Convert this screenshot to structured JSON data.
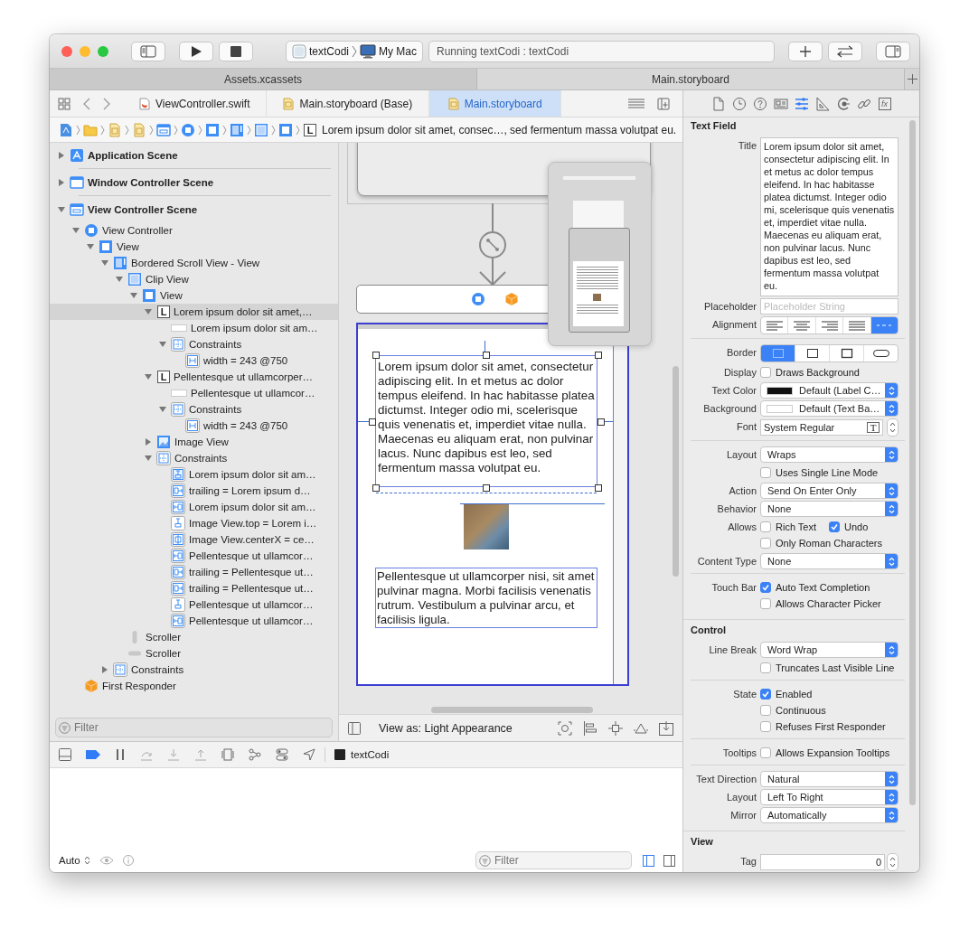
{
  "toolbar": {
    "scheme": {
      "target": "textCodi",
      "destination": "My Mac"
    },
    "activity": "Running textCodi : textCodi"
  },
  "window_tabs": [
    {
      "label": "Assets.xcassets",
      "selected": false
    },
    {
      "label": "Main.storyboard",
      "selected": true
    }
  ],
  "editor_tabs": [
    {
      "label": "ViewController.swift",
      "kind": "swift",
      "selected": false
    },
    {
      "label": "Main.storyboard (Base)",
      "kind": "storyboard",
      "selected": false
    },
    {
      "label": "Main.storyboard",
      "kind": "storyboard",
      "selected": true
    }
  ],
  "jump_bar": {
    "crumbs": [
      {
        "kind": "project"
      },
      {
        "kind": "folder"
      },
      {
        "kind": "storyboard"
      },
      {
        "kind": "storyboard"
      },
      {
        "kind": "vc-scene"
      },
      {
        "kind": "view-controller"
      },
      {
        "kind": "view"
      },
      {
        "kind": "scroll-view"
      },
      {
        "kind": "clip-view"
      },
      {
        "kind": "view"
      },
      {
        "kind": "label",
        "badge": "L",
        "label": "Lorem ipsum dolor sit amet, consec…, sed fermentum massa volutpat eu."
      }
    ]
  },
  "outline": [
    {
      "label": "Application Scene",
      "kind": "app-scene",
      "expanded": false,
      "selected": false
    },
    {
      "label": "Window Controller Scene",
      "kind": "window-scene",
      "expanded": false,
      "selected": false
    },
    {
      "label": "View Controller Scene",
      "kind": "vc-scene",
      "expanded": true,
      "selected": false,
      "children": [
        {
          "label": "View Controller",
          "kind": "view-controller",
          "expanded": true,
          "selected": false,
          "children": [
            {
              "label": "View",
              "kind": "view",
              "expanded": true,
              "selected": false,
              "children": [
                {
                  "label": "Bordered Scroll View - View",
                  "kind": "scroll-view",
                  "expanded": true,
                  "selected": false,
                  "children": [
                    {
                      "label": "Clip View",
                      "kind": "clip-view",
                      "expanded": true,
                      "selected": false,
                      "children": [
                        {
                          "label": "View",
                          "kind": "view",
                          "expanded": true,
                          "selected": false,
                          "children": [
                            {
                              "label": "Lorem ipsum dolor sit amet,…",
                              "kind": "label",
                              "badge": "L",
                              "expanded": true,
                              "selected": true,
                              "children": [
                                {
                                  "label": "Lorem ipsum dolor sit am…",
                                  "kind": "text-cell",
                                  "selected": false
                                },
                                {
                                  "label": "Constraints",
                                  "kind": "constraints",
                                  "expanded": true,
                                  "selected": false,
                                  "children": [
                                    {
                                      "label": "width = 243 @750",
                                      "kind": "width-constraint",
                                      "selected": false
                                    }
                                  ]
                                }
                              ]
                            },
                            {
                              "label": "Pellentesque ut ullamcorper…",
                              "kind": "label",
                              "badge": "L",
                              "expanded": true,
                              "selected": false,
                              "children": [
                                {
                                  "label": "Pellentesque ut ullamcor…",
                                  "kind": "text-cell",
                                  "selected": false
                                },
                                {
                                  "label": "Constraints",
                                  "kind": "constraints",
                                  "expanded": true,
                                  "selected": false,
                                  "children": [
                                    {
                                      "label": "width = 243 @750",
                                      "kind": "width-constraint",
                                      "selected": false
                                    }
                                  ]
                                }
                              ]
                            },
                            {
                              "label": "Image View",
                              "kind": "image-view",
                              "expanded": false,
                              "selected": false
                            },
                            {
                              "label": "Constraints",
                              "kind": "constraints",
                              "expanded": true,
                              "selected": false,
                              "children": [
                                {
                                  "label": "Lorem ipsum dolor sit am…",
                                  "kind": "vertical-constraint",
                                  "selected": false
                                },
                                {
                                  "label": "trailing = Lorem ipsum d…",
                                  "kind": "trailing-constraint",
                                  "selected": false
                                },
                                {
                                  "label": "Lorem ipsum dolor sit am…",
                                  "kind": "leading-constraint",
                                  "selected": false
                                },
                                {
                                  "label": "Image View.top = Lorem i…",
                                  "kind": "top-constraint",
                                  "selected": false
                                },
                                {
                                  "label": "Image View.centerX = ce…",
                                  "kind": "center-constraint",
                                  "selected": false
                                },
                                {
                                  "label": "Pellentesque ut ullamcor…",
                                  "kind": "leading-constraint",
                                  "selected": false
                                },
                                {
                                  "label": "trailing = Pellentesque ut…",
                                  "kind": "trailing-constraint",
                                  "selected": false
                                },
                                {
                                  "label": "trailing = Pellentesque ut…",
                                  "kind": "trailing-constraint",
                                  "selected": false
                                },
                                {
                                  "label": "Pellentesque ut ullamcor…",
                                  "kind": "top-constraint",
                                  "selected": false
                                },
                                {
                                  "label": "Pellentesque ut ullamcor…",
                                  "kind": "leading-constraint",
                                  "selected": false
                                }
                              ]
                            }
                          ]
                        }
                      ]
                    },
                    {
                      "label": "Scroller",
                      "kind": "scroller-v",
                      "selected": false
                    },
                    {
                      "label": "Scroller",
                      "kind": "scroller-h",
                      "selected": false
                    }
                  ]
                },
                {
                  "label": "Constraints",
                  "kind": "constraints",
                  "expanded": false,
                  "selected": false
                }
              ]
            }
          ]
        },
        {
          "label": "First Responder",
          "kind": "first-responder",
          "selected": false
        }
      ]
    }
  ],
  "outline_filter": {
    "placeholder": "Filter"
  },
  "canvas": {
    "labels": [
      "Lorem ipsum dolor sit amet, consectetur adipiscing elit. In et metus ac dolor tempus eleifend. In hac habitasse platea dictumst. Integer odio mi, scelerisque quis venenatis et, imperdiet vitae nulla. Maecenas eu aliquam erat, non pulvinar lacus. Nunc dapibus est leo, sed fermentum massa volutpat eu.",
      "Pellentesque ut ullamcorper nisi, sit amet pulvinar magna. Morbi facilisis venenatis rutrum. Vestibulum a pulvinar arcu, et facilisis ligula."
    ],
    "view_as": "View as: Light Appearance"
  },
  "debug_bar": {
    "process": "textCodi"
  },
  "console": {
    "mode": "Auto",
    "filter": {
      "placeholder": "Filter"
    }
  },
  "inspector": {
    "tabs": [
      {
        "kind": "file",
        "selected": false
      },
      {
        "kind": "history",
        "selected": false
      },
      {
        "kind": "help",
        "selected": false
      },
      {
        "kind": "identity",
        "selected": false
      },
      {
        "kind": "attributes",
        "selected": true
      },
      {
        "kind": "size",
        "selected": false
      },
      {
        "kind": "connections",
        "selected": false
      },
      {
        "kind": "bindings",
        "selected": false
      },
      {
        "kind": "effects",
        "glyph": "fx",
        "selected": false
      }
    ],
    "sections": [
      {
        "title": "Text Field",
        "groups": [
          {
            "rows": [
              {
                "kind": "textarea",
                "label": "Title",
                "value": "Lorem ipsum dolor sit amet, consectetur adipiscing elit. In et metus ac dolor tempus eleifend. In hac habitasse platea dictumst. Integer odio mi, scelerisque quis venenatis et, imperdiet vitae nulla. Maecenas eu aliquam erat, non pulvinar lacus. Nunc dapibus est leo, sed fermentum massa volutpat eu."
              },
              {
                "kind": "field",
                "label": "Placeholder",
                "placeholder": "Placeholder String"
              },
              {
                "kind": "segmented",
                "label": "Alignment",
                "segments": [
                  {
                    "kind": "align-left",
                    "selected": false
                  },
                  {
                    "kind": "align-center",
                    "selected": false
                  },
                  {
                    "kind": "align-right",
                    "selected": false
                  },
                  {
                    "kind": "align-justify",
                    "selected": false
                  },
                  {
                    "kind": "align-natural",
                    "selected": true
                  }
                ]
              }
            ]
          },
          {
            "rows": [
              {
                "kind": "segmented",
                "label": "Border",
                "segments": [
                  {
                    "kind": "border-none",
                    "selected": true
                  },
                  {
                    "kind": "border-line",
                    "selected": false
                  },
                  {
                    "kind": "border-bezel",
                    "selected": false
                  },
                  {
                    "kind": "border-rounded",
                    "selected": false
                  }
                ]
              },
              {
                "kind": "checks",
                "label": "Display",
                "lines": [
                  [
                    {
                      "label": "Draws Background",
                      "checked": false
                    }
                  ]
                ]
              },
              {
                "kind": "popup",
                "label": "Text Color",
                "value": "Default (Label C…",
                "color": "#111111"
              },
              {
                "kind": "popup",
                "label": "Background",
                "value": "Default (Text Ba…",
                "color": "#ffffff"
              },
              {
                "kind": "font",
                "label": "Font",
                "value": "System Regular",
                "glyph": "T"
              }
            ]
          },
          {
            "rows": [
              {
                "kind": "popup",
                "label": "Layout",
                "value": "Wraps"
              },
              {
                "kind": "checks",
                "lines": [
                  [
                    {
                      "label": "Uses Single Line Mode",
                      "checked": false
                    }
                  ]
                ]
              },
              {
                "kind": "popup",
                "label": "Action",
                "value": "Send On Enter Only"
              },
              {
                "kind": "popup",
                "label": "Behavior",
                "value": "None"
              },
              {
                "kind": "checks",
                "label": "Allows",
                "lines": [
                  [
                    {
                      "label": "Rich Text",
                      "checked": false
                    },
                    {
                      "label": "Undo",
                      "checked": true
                    }
                  ],
                  [
                    {
                      "label": "Only Roman Characters",
                      "checked": false
                    }
                  ]
                ]
              },
              {
                "kind": "popup",
                "label": "Content Type",
                "value": "None"
              }
            ]
          },
          {
            "rows": [
              {
                "kind": "checks",
                "label": "Touch Bar",
                "lines": [
                  [
                    {
                      "label": "Auto Text Completion",
                      "checked": true
                    }
                  ],
                  [
                    {
                      "label": "Allows Character Picker",
                      "checked": false
                    }
                  ]
                ]
              }
            ]
          }
        ]
      },
      {
        "title": "Control",
        "groups": [
          {
            "rows": [
              {
                "kind": "popup",
                "label": "Line Break",
                "value": "Word Wrap"
              },
              {
                "kind": "checks",
                "lines": [
                  [
                    {
                      "label": "Truncates Last Visible Line",
                      "checked": false
                    }
                  ]
                ]
              }
            ]
          },
          {
            "rows": [
              {
                "kind": "checks",
                "label": "State",
                "lines": [
                  [
                    {
                      "label": "Enabled",
                      "checked": true
                    }
                  ],
                  [
                    {
                      "label": "Continuous",
                      "checked": false
                    }
                  ],
                  [
                    {
                      "label": "Refuses First Responder",
                      "checked": false
                    }
                  ]
                ]
              }
            ]
          },
          {
            "rows": [
              {
                "kind": "checks",
                "label": "Tooltips",
                "lines": [
                  [
                    {
                      "label": "Allows Expansion Tooltips",
                      "checked": false
                    }
                  ]
                ]
              }
            ]
          },
          {
            "rows": [
              {
                "kind": "popup",
                "label": "Text Direction",
                "value": "Natural"
              },
              {
                "kind": "popup",
                "label": "Layout",
                "value": "Left To Right"
              },
              {
                "kind": "popup",
                "label": "Mirror",
                "value": "Automatically"
              }
            ]
          }
        ]
      },
      {
        "title": "View",
        "groups": [
          {
            "rows": [
              {
                "kind": "stepper",
                "label": "Tag",
                "value": "0"
              }
            ]
          }
        ]
      }
    ]
  }
}
